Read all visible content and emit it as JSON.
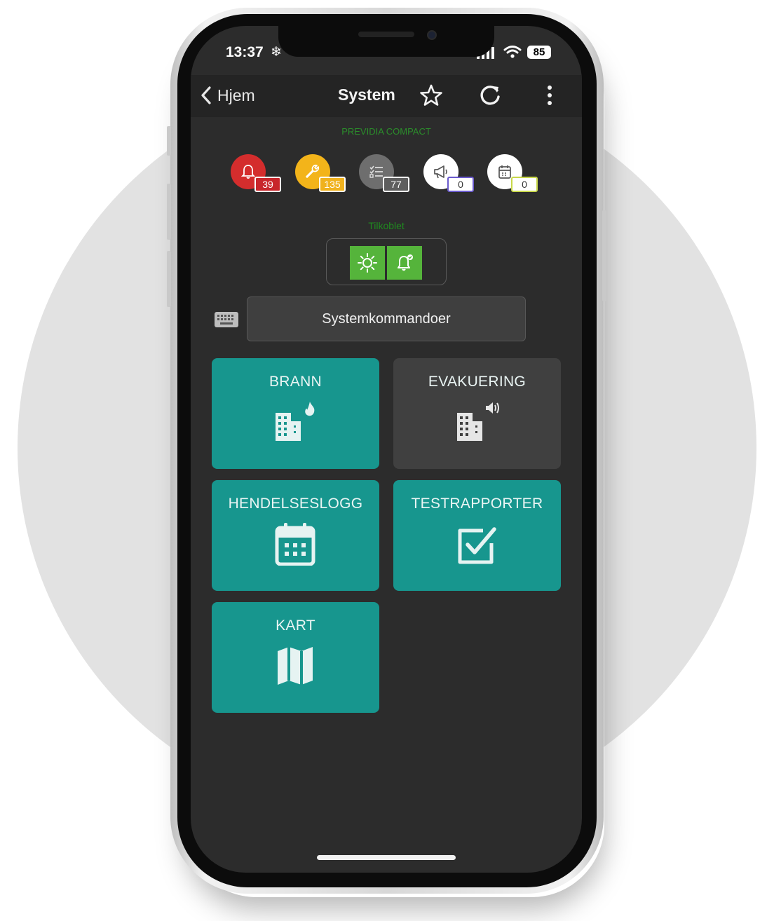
{
  "status_bar": {
    "time": "13:37",
    "time_icon": "snowflake-icon",
    "battery": "85"
  },
  "nav": {
    "back_label": "Hjem",
    "title": "System",
    "icons": [
      "chevron-left-icon",
      "star-icon",
      "refresh-icon",
      "more-vertical-icon"
    ]
  },
  "system": {
    "name": "PREVIDIA COMPACT",
    "counters": [
      {
        "name": "alarm",
        "icon": "bell-icon",
        "count": "39",
        "color": "#d42d2d",
        "badge_bg": "#c8262b",
        "badge_fg": "#ffffff"
      },
      {
        "name": "fault",
        "icon": "wrench-icon",
        "count": "135",
        "color": "#f3b41a",
        "badge_bg": "#f0b21e",
        "badge_fg": "#ffffff"
      },
      {
        "name": "disablement",
        "icon": "checklist-icon",
        "count": "77",
        "color": "#6e6e6e",
        "badge_bg": "#5e5e5e",
        "badge_fg": "#ffffff"
      },
      {
        "name": "evacuation",
        "icon": "megaphone-icon",
        "count": "0",
        "color": "#ffffff",
        "badge_bg": "#ffffff",
        "badge_fg": "#333333"
      },
      {
        "name": "test",
        "icon": "calendar-icon",
        "count": "0",
        "color": "#ffffff",
        "badge_bg": "#ffffff",
        "badge_fg": "#333333"
      }
    ],
    "connection_label": "Tilkoblet",
    "connection_color": "#55b43b"
  },
  "commands": {
    "label": "Systemkommandoer",
    "icon": "keyboard-icon"
  },
  "tiles": [
    {
      "label": "BRANN",
      "icon": "building-fire-icon",
      "color": "#17968e"
    },
    {
      "label": "EVAKUERING",
      "icon": "building-speaker-icon",
      "color": "#404040"
    },
    {
      "label": "HENDELSESLOGG",
      "icon": "calendar-icon",
      "color": "#17968e"
    },
    {
      "label": "TESTRAPPORTER",
      "icon": "checkbox-icon",
      "color": "#17968e"
    },
    {
      "label": "KART",
      "icon": "map-icon",
      "color": "#17968e"
    }
  ],
  "colors": {
    "accent": "#17968e",
    "screen_bg": "#2c2c2c",
    "navbar_bg": "#242424"
  }
}
